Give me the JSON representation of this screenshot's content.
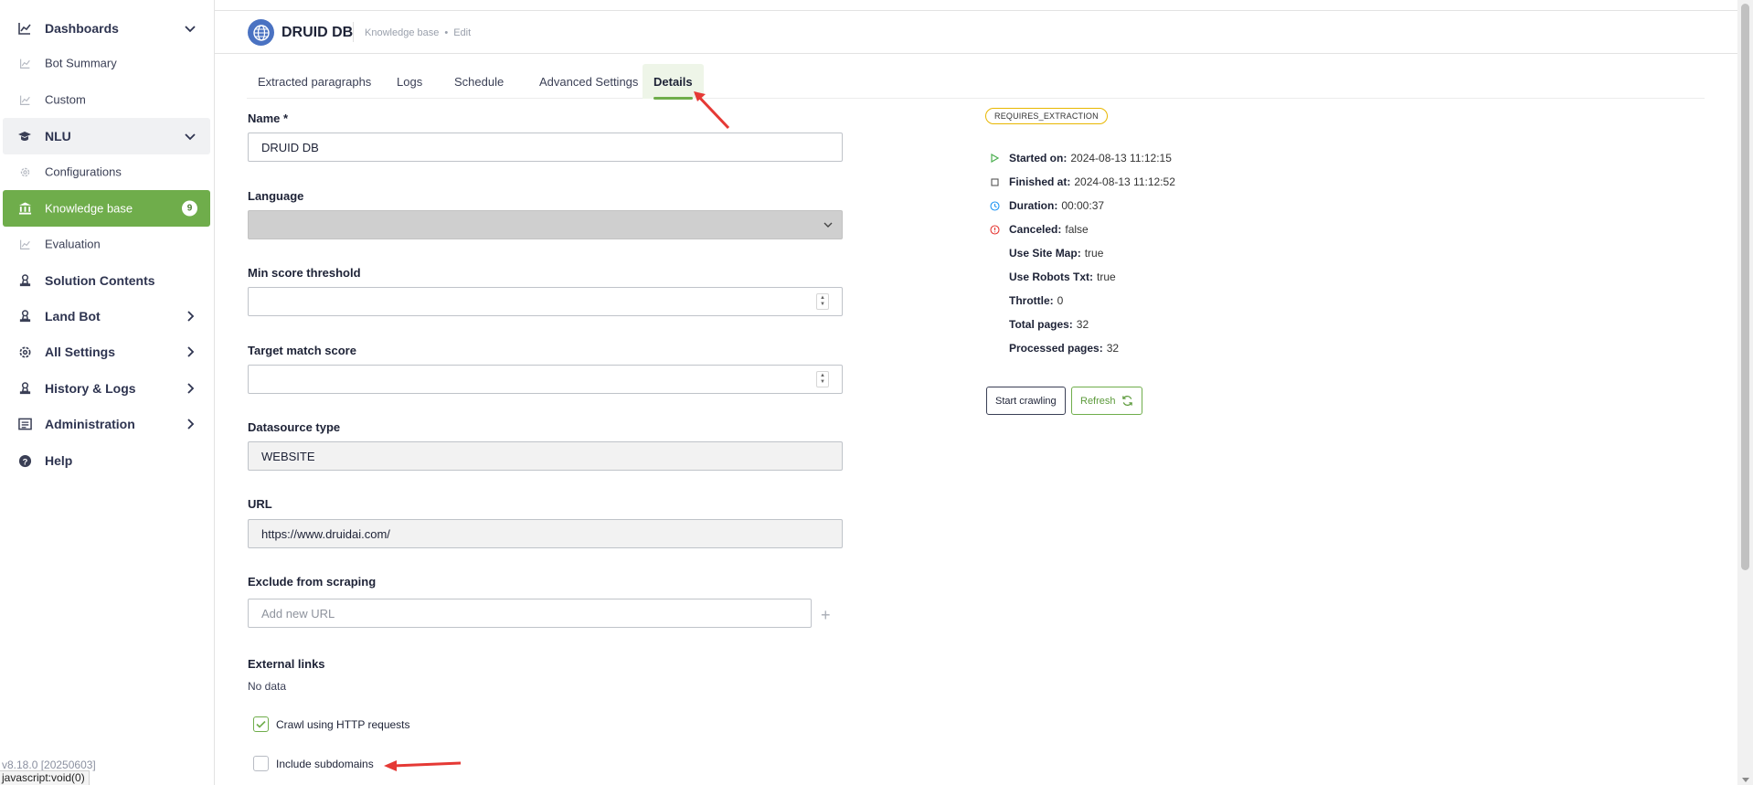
{
  "sidebar": {
    "items": [
      {
        "label": "Dashboards",
        "icon": "chart-icon"
      },
      {
        "label": "Bot Summary",
        "icon": "chart-icon"
      },
      {
        "label": "Custom",
        "icon": "chart-icon"
      },
      {
        "label": "NLU",
        "icon": "graduation-cap-icon"
      },
      {
        "label": "Configurations",
        "icon": "gear-icon"
      },
      {
        "label": "Knowledge base",
        "icon": "bank-icon",
        "badge": "9"
      },
      {
        "label": "Evaluation",
        "icon": "chart-icon"
      },
      {
        "label": "Solution Contents",
        "icon": "stamp-icon"
      },
      {
        "label": "Land Bot",
        "icon": "stamp-icon"
      },
      {
        "label": "All Settings",
        "icon": "gear-icon"
      },
      {
        "label": "History & Logs",
        "icon": "stamp-icon"
      },
      {
        "label": "Administration",
        "icon": "list-icon"
      },
      {
        "label": "Help",
        "icon": "help-icon"
      }
    ],
    "version": "v8.18.0 [20250603]"
  },
  "statusbar": {
    "text": "javascript:void(0)"
  },
  "header": {
    "title": "DRUID DB",
    "breadcrumb": [
      "Knowledge base",
      "Edit"
    ]
  },
  "tabs": [
    "Extracted paragraphs",
    "Logs",
    "Schedule",
    "Advanced Settings",
    "Details"
  ],
  "form": {
    "name": {
      "label": "Name *",
      "value": "DRUID DB"
    },
    "language": {
      "label": "Language",
      "value": ""
    },
    "min_score": {
      "label": "Min score threshold",
      "value": ""
    },
    "target_match": {
      "label": "Target match score",
      "value": ""
    },
    "datasource": {
      "label": "Datasource type",
      "value": "WEBSITE"
    },
    "url": {
      "label": "URL",
      "value": "https://www.druidai.com/"
    },
    "exclude": {
      "label": "Exclude from scraping",
      "placeholder": "Add new URL"
    },
    "external_links": {
      "label": "External links",
      "empty": "No data"
    },
    "crawl_http": {
      "label": "Crawl using HTTP requests",
      "checked": true
    },
    "include_subdomains": {
      "label": "Include subdomains",
      "checked": false
    }
  },
  "details": {
    "status": "REQUIRES_EXTRACTION",
    "rows": [
      {
        "key": "Started on:",
        "value": "2024-08-13 11:12:15",
        "icon": "play-icon",
        "color": "#4caf50"
      },
      {
        "key": "Finished at:",
        "value": "2024-08-13 11:12:52",
        "icon": "stop-icon",
        "color": "#555555"
      },
      {
        "key": "Duration:",
        "value": "00:00:37",
        "icon": "clock-icon",
        "color": "#2196f3"
      },
      {
        "key": "Canceled:",
        "value": "false",
        "icon": "alert-icon",
        "color": "#e53935"
      },
      {
        "key": "Use Site Map:",
        "value": "true"
      },
      {
        "key": "Use Robots Txt:",
        "value": "true"
      },
      {
        "key": "Throttle:",
        "value": "0"
      },
      {
        "key": "Total pages:",
        "value": "32"
      },
      {
        "key": "Processed pages:",
        "value": "32"
      }
    ],
    "buttons": {
      "start": "Start crawling",
      "refresh": "Refresh"
    }
  },
  "colors": {
    "accent": "#6fad4b",
    "status_border": "#e8b700",
    "annotation": "#e53935"
  }
}
